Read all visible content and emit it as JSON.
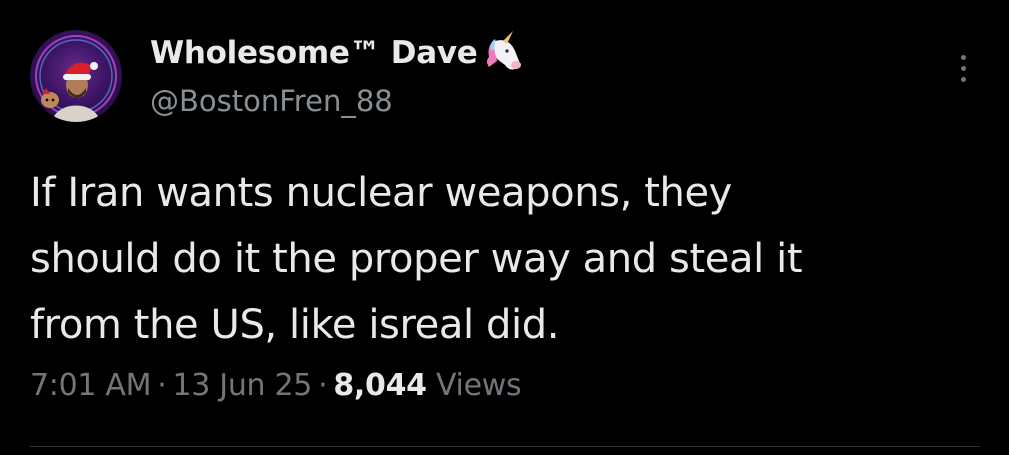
{
  "author": {
    "display_name": "Wholesome™ Dave",
    "handle": "@BostonFren_88",
    "badge_icon": "unicorn-icon",
    "avatar_icon": "avatar-photo"
  },
  "tweet": {
    "text_lines": [
      "If Iran wants nuclear weapons, they",
      "should do it the proper way and steal it",
      "from the US, like isreal did."
    ]
  },
  "meta": {
    "time": "7:01 AM",
    "separator": "·",
    "date": "13 Jun 25",
    "views_count": "8,044",
    "views_label": "Views"
  },
  "more_icon": "more-vertical-icon",
  "colors": {
    "background": "#000000",
    "primary_text": "#e7e9ea",
    "secondary_text": "#71767b",
    "divider": "#2f3336"
  }
}
